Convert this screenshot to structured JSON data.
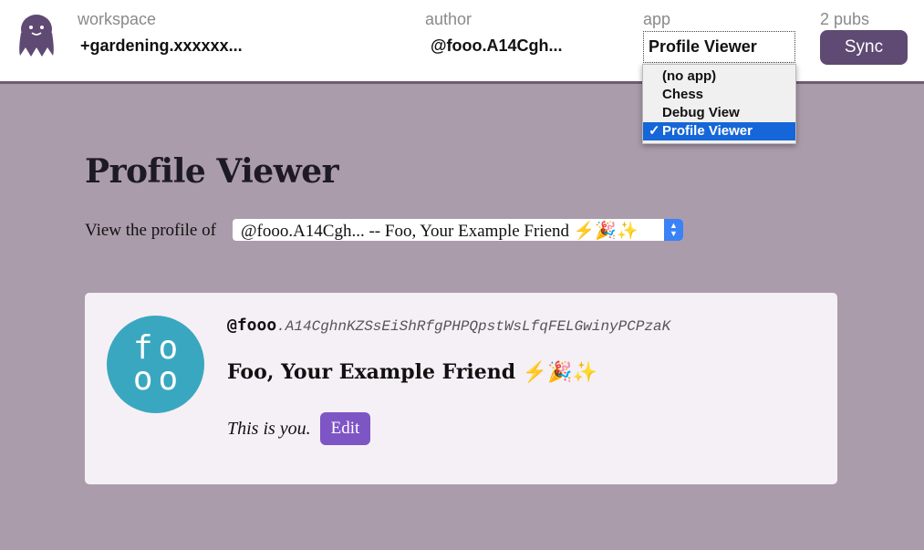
{
  "topbar": {
    "workspace": {
      "label": "workspace",
      "value": "+gardening.xxxxxx..."
    },
    "author": {
      "label": "author",
      "value": "@fooo.A14Cgh..."
    },
    "app": {
      "label": "app",
      "value": "Profile Viewer"
    },
    "pubs": {
      "label": "2 pubs"
    },
    "sync_label": "Sync",
    "colors": {
      "accent": "#5e4a72",
      "border": "#705c70"
    }
  },
  "app_dropdown": {
    "options": [
      "(no app)",
      "Chess",
      "Debug View",
      "Profile Viewer"
    ],
    "selected": "Profile Viewer",
    "check": "✓",
    "highlight_color": "#1566d8"
  },
  "main": {
    "title": "Profile Viewer",
    "viewer_label": "View the profile of",
    "profile_select_value": "@fooo.A14Cgh... -- Foo, Your Example Friend ⚡🎉✨",
    "background": "#ab9cab"
  },
  "profile": {
    "avatar_lines": [
      "fo",
      "oo"
    ],
    "avatar_color": "#3aa7c0",
    "address_short": "@fooo",
    "address_key": ".A14CghnKZSsEiShRfgPHPQpstWsLfqFELGwinyPCPzaK",
    "display_name": "Foo, Your Example Friend ⚡🎉✨",
    "you_text": "This is you.",
    "edit_label": "Edit",
    "edit_color": "#7e55c5"
  }
}
